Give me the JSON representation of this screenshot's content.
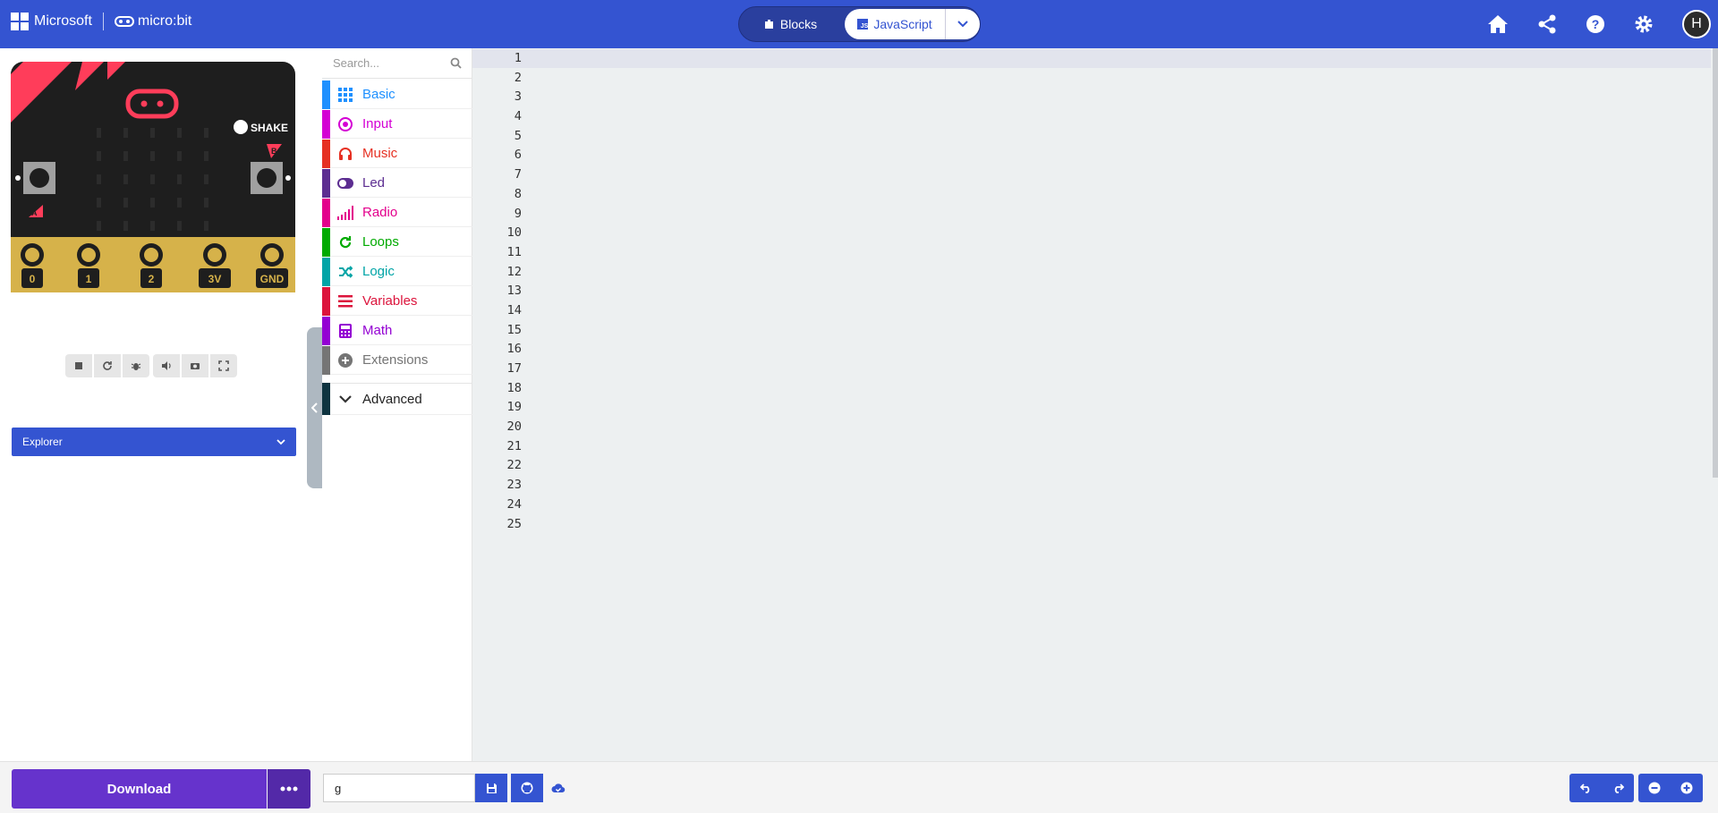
{
  "header": {
    "microsoft_label": "Microsoft",
    "product_label": "micro:bit",
    "toggle": {
      "blocks_label": "Blocks",
      "javascript_label": "JavaScript"
    },
    "avatar_initial": "H"
  },
  "simulator": {
    "shake_label": "SHAKE",
    "button_a": "A",
    "button_b": "B",
    "pins": [
      "0",
      "1",
      "2",
      "3V",
      "GND"
    ]
  },
  "explorer_label": "Explorer",
  "toolbox": {
    "search_placeholder": "Search...",
    "categories": [
      {
        "label": "Basic",
        "color": "#1e90ff"
      },
      {
        "label": "Input",
        "color": "#d400d4"
      },
      {
        "label": "Music",
        "color": "#e63022"
      },
      {
        "label": "Led",
        "color": "#5c2d91"
      },
      {
        "label": "Radio",
        "color": "#e3008c"
      },
      {
        "label": "Loops",
        "color": "#00aa00"
      },
      {
        "label": "Logic",
        "color": "#00a4a6"
      },
      {
        "label": "Variables",
        "color": "#dc143c"
      },
      {
        "label": "Math",
        "color": "#9400d3"
      },
      {
        "label": "Extensions",
        "color": "#757575"
      }
    ],
    "advanced_label": "Advanced"
  },
  "editor": {
    "line_numbers": [
      "1",
      "2",
      "3",
      "4",
      "5",
      "6",
      "7",
      "8",
      "9",
      "10",
      "11",
      "12",
      "13",
      "14",
      "15",
      "16",
      "17",
      "18",
      "19",
      "20",
      "21",
      "22",
      "23",
      "24",
      "25"
    ]
  },
  "footer": {
    "download_label": "Download",
    "project_name": "g"
  }
}
